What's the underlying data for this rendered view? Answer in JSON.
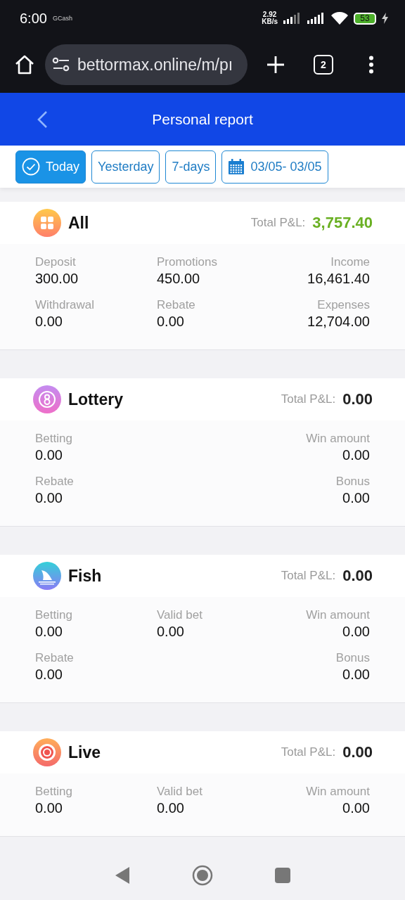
{
  "status_bar": {
    "time": "6:00",
    "app_label": "GCash",
    "speed": "2.92",
    "speed_unit": "KB/s",
    "battery": "53"
  },
  "browser": {
    "url": "bettormax.online/m/pı",
    "tab_count": "2"
  },
  "header": {
    "title": "Personal report"
  },
  "filters": [
    {
      "label": "Today",
      "kind": "check",
      "selected": true
    },
    {
      "label": "Yesterday",
      "kind": "plain",
      "selected": false
    },
    {
      "label": "7-days",
      "kind": "plain",
      "selected": false
    },
    {
      "label": "03/05- 03/05",
      "kind": "date",
      "selected": false
    }
  ],
  "cards": [
    {
      "title": "All",
      "total_label": "Total P&L:",
      "total": "3,757.40",
      "positive": true,
      "rows": [
        {
          "left": {
            "label": "Deposit",
            "value": "300.00"
          },
          "middle": {
            "label": "Promotions",
            "value": "450.00"
          },
          "right": {
            "label": "Income",
            "value": "16,461.40"
          }
        },
        {
          "left": {
            "label": "Withdrawal",
            "value": "0.00"
          },
          "middle": {
            "label": "Rebate",
            "value": "0.00"
          },
          "right": {
            "label": "Expenses",
            "value": "12,704.00"
          }
        }
      ]
    },
    {
      "title": "Lottery",
      "total_label": "Total P&L:",
      "total": "0.00",
      "positive": false,
      "rows": [
        {
          "left": {
            "label": "Betting",
            "value": "0.00"
          },
          "right": {
            "label": "Win amount",
            "value": "0.00"
          }
        },
        {
          "left": {
            "label": "Rebate",
            "value": "0.00"
          },
          "right": {
            "label": "Bonus",
            "value": "0.00"
          }
        }
      ]
    },
    {
      "title": "Fish",
      "total_label": "Total P&L:",
      "total": "0.00",
      "positive": false,
      "rows": [
        {
          "left": {
            "label": "Betting",
            "value": "0.00"
          },
          "middle": {
            "label": "Valid bet",
            "value": "0.00"
          },
          "right": {
            "label": "Win amount",
            "value": "0.00"
          }
        },
        {
          "left": {
            "label": "Rebate",
            "value": "0.00"
          },
          "right": {
            "label": "Bonus",
            "value": "0.00"
          }
        }
      ]
    },
    {
      "title": "Live",
      "total_label": "Total P&L:",
      "total": "0.00",
      "positive": false,
      "rows": [
        {
          "left": {
            "label": "Betting",
            "value": "0.00"
          },
          "middle": {
            "label": "Valid bet",
            "value": "0.00"
          },
          "right": {
            "label": "Win amount",
            "value": "0.00"
          }
        }
      ]
    }
  ]
}
